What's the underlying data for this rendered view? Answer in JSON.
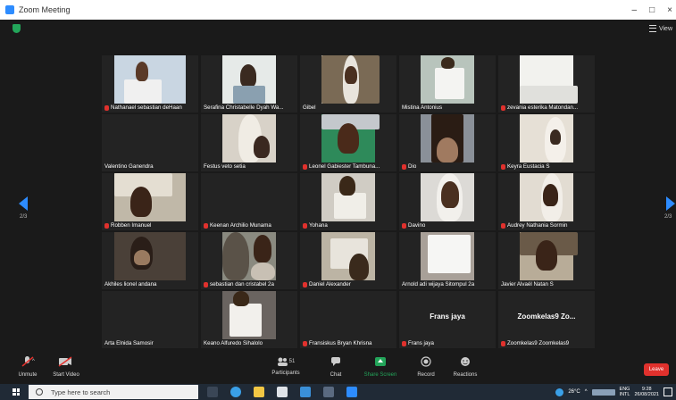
{
  "window": {
    "title": "Zoom Meeting",
    "minimize": "–",
    "maximize": "□",
    "close": "×"
  },
  "topbar": {
    "view_label": "View"
  },
  "nav": {
    "page_left": "2/3",
    "page_right": "2/3"
  },
  "participants": [
    {
      "name": "Nathanael sebastian deHaan",
      "muted": true,
      "video": "boy-paper"
    },
    {
      "name": "Serafina Christabelle Dyah Wa...",
      "muted": false,
      "video": "girl-white"
    },
    {
      "name": "Gibel",
      "muted": false,
      "video": "boy-door"
    },
    {
      "name": "Mistina Antonius",
      "muted": false,
      "video": "girl-paper"
    },
    {
      "name": "zevania esterika Matondan...",
      "muted": true,
      "video": "paper-text"
    },
    {
      "name": "Valentino Ganendra",
      "muted": false,
      "video": ""
    },
    {
      "name": "Festus veto setia",
      "muted": false,
      "video": "boy-side"
    },
    {
      "name": "Leonel Gabiester Tambuna...",
      "muted": true,
      "video": "boy-green"
    },
    {
      "name": "Dio",
      "muted": true,
      "video": "boy-close"
    },
    {
      "name": "Keyra Eustacia S",
      "muted": true,
      "video": "girl-room"
    },
    {
      "name": "Robben Imanuel",
      "muted": true,
      "video": "boy-room"
    },
    {
      "name": "Keenan Archilio Munama",
      "muted": true,
      "video": ""
    },
    {
      "name": "Yohana",
      "muted": true,
      "video": "girl-paper2"
    },
    {
      "name": "Davino",
      "muted": true,
      "video": "boy-front"
    },
    {
      "name": "Audrey Nathania Sormin",
      "muted": true,
      "video": "girl-wall"
    },
    {
      "name": "Akhiles lionel andana",
      "muted": false,
      "video": "boy-dark"
    },
    {
      "name": "sebastian dan cristabel 2a",
      "muted": true,
      "video": "two-kids"
    },
    {
      "name": "Daniel Alexander",
      "muted": true,
      "video": "boy-writing"
    },
    {
      "name": "Arnold adi wijaya Sitompul 2a",
      "muted": false,
      "video": "paper-white"
    },
    {
      "name": "Javier Alvaél Natan S",
      "muted": false,
      "video": "boy-home"
    },
    {
      "name": "Arta Elnida Samosir",
      "muted": false,
      "video": ""
    },
    {
      "name": "Keano Alfuredo Sihalolo",
      "muted": false,
      "video": "boy-paper3"
    },
    {
      "name": "Fransiskus Bryan Khrisna",
      "muted": true,
      "video": ""
    },
    {
      "name": "Frans jaya",
      "muted": true,
      "video": "",
      "display": "Frans jaya"
    },
    {
      "name": "Zoomkelas9 Zoomkelas9",
      "muted": true,
      "video": "",
      "display": "Zoomkelas9  Zo..."
    }
  ],
  "toolbar": {
    "unmute": "Unmute",
    "start_video": "Start Video",
    "participants": "Participants",
    "participants_count": "51",
    "chat": "Chat",
    "share_screen": "Share Screen",
    "record": "Record",
    "reactions": "Reactions",
    "leave": "Leave"
  },
  "taskbar": {
    "search_placeholder": "Type here to search",
    "temperature": "26°C",
    "language": "ENG",
    "language_sub": "INTL",
    "time": "9:28",
    "date": "26/08/2021"
  },
  "colors": {
    "accent": "#2d8cff",
    "leave": "#e0312d",
    "muted": "#e0312d",
    "share": "#23a55a"
  }
}
